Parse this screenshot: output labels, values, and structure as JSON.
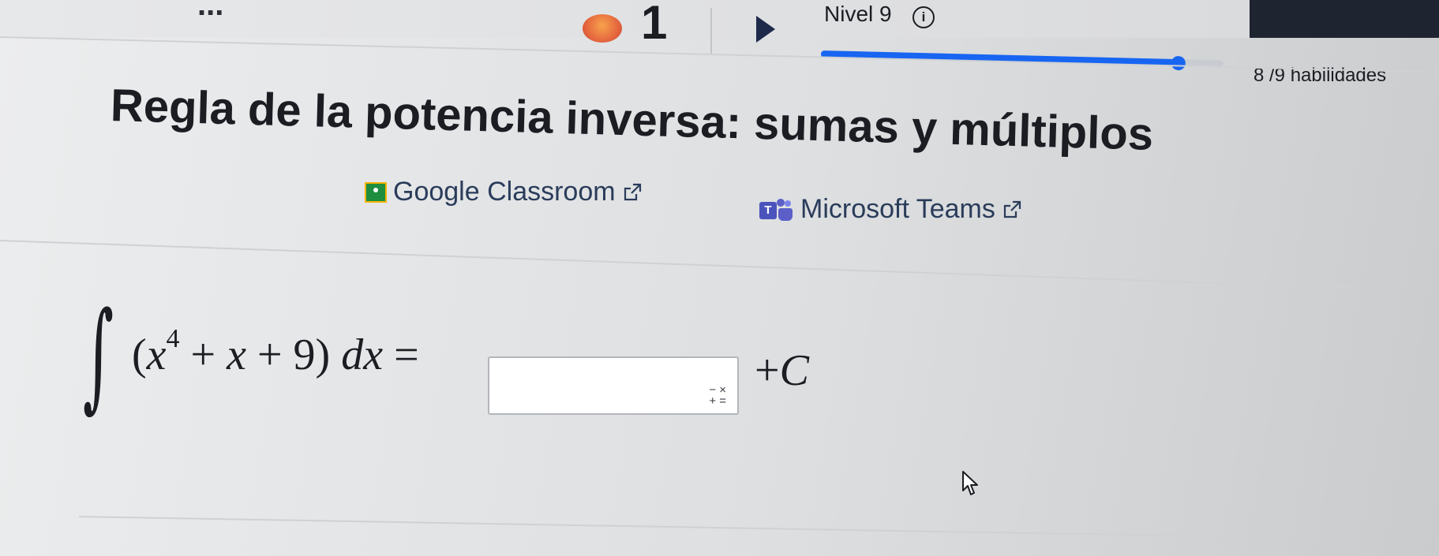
{
  "header": {
    "truncated_text": "...",
    "streak_count": "1",
    "level_label": "Nivel 9",
    "info_glyph": "i",
    "progress": {
      "completed": 8,
      "total": 9,
      "label": "8 /9 habilidades",
      "accent_color": "#1865f2"
    }
  },
  "lesson": {
    "title": "Regla de la potencia inversa: sumas y múltiplos"
  },
  "share": {
    "google_classroom": {
      "label": "Google Classroom",
      "icon": "google-classroom-icon"
    },
    "microsoft_teams": {
      "label": "Microsoft Teams",
      "icon": "microsoft-teams-icon"
    }
  },
  "problem": {
    "integral_symbol": "∫",
    "open_paren": "(",
    "var_x": "x",
    "exponent": "4",
    "rest_expression": " + ",
    "var_x2": "x",
    "tail": " + 9) ",
    "dx": "dx",
    "equals": " = ",
    "answer_value": "",
    "keypad_top": "− ×",
    "keypad_bottom": "+ =",
    "constant_plus": "+",
    "constant_c": "C"
  },
  "icons": [
    "streak-flame-icon",
    "play-icon",
    "info-icon",
    "external-link-icon",
    "math-keypad-icon",
    "mouse-cursor-icon"
  ]
}
